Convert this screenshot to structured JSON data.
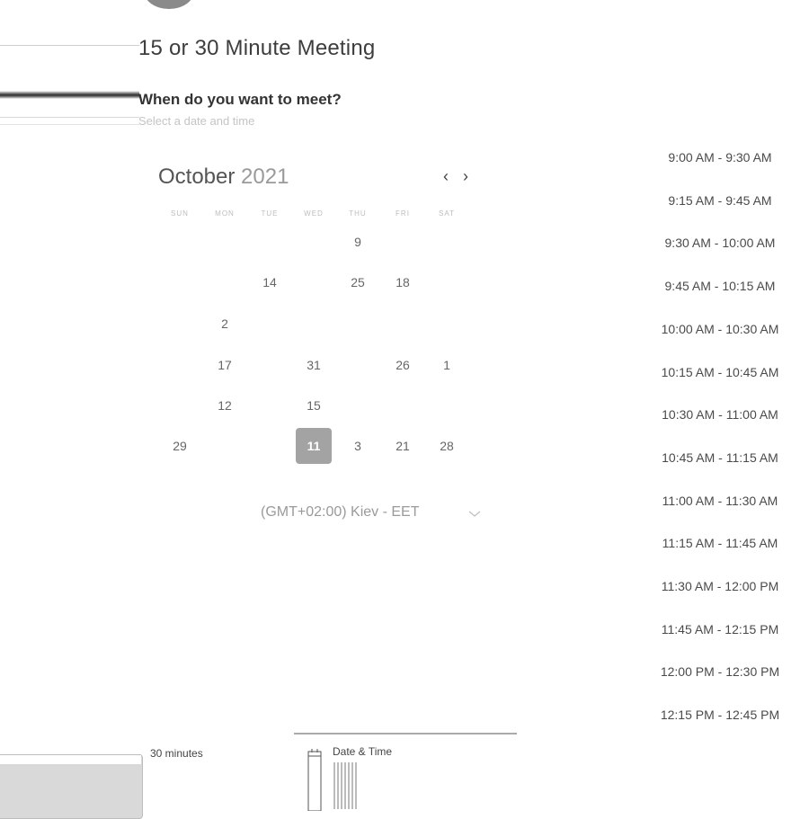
{
  "meeting": {
    "title": "15 or 30 Minute Meeting",
    "question": "When do you want to meet?",
    "hint": "Select a date and time"
  },
  "calendar": {
    "month": "October",
    "year": "2021",
    "weekdays": [
      "SUN",
      "MON",
      "TUE",
      "WED",
      "THU",
      "FRI",
      "SAT"
    ],
    "days": [
      {
        "label": "9",
        "col": 4,
        "row": 0,
        "selected": false
      },
      {
        "label": "14",
        "col": 2,
        "row": 1,
        "selected": false
      },
      {
        "label": "25",
        "col": 4,
        "row": 1,
        "selected": false
      },
      {
        "label": "18",
        "col": 5,
        "row": 1,
        "selected": false
      },
      {
        "label": "2",
        "col": 1,
        "row": 2,
        "selected": false
      },
      {
        "label": "17",
        "col": 1,
        "row": 3,
        "selected": false
      },
      {
        "label": "31",
        "col": 3,
        "row": 3,
        "selected": false
      },
      {
        "label": "26",
        "col": 5,
        "row": 3,
        "selected": false
      },
      {
        "label": "1",
        "col": 6,
        "row": 3,
        "selected": false
      },
      {
        "label": "12",
        "col": 1,
        "row": 4,
        "selected": false
      },
      {
        "label": "15",
        "col": 3,
        "row": 4,
        "selected": false
      },
      {
        "label": "29",
        "col": 0,
        "row": 5,
        "selected": false
      },
      {
        "label": "11",
        "col": 3,
        "row": 5,
        "selected": true
      },
      {
        "label": "3",
        "col": 4,
        "row": 5,
        "selected": false
      },
      {
        "label": "21",
        "col": 5,
        "row": 5,
        "selected": false
      },
      {
        "label": "28",
        "col": 6,
        "row": 5,
        "selected": false
      }
    ],
    "prev_icon": "chevron-left-icon",
    "next_icon": "chevron-right-icon"
  },
  "timezone": {
    "label": "(GMT+02:00) Kiev - EET",
    "icon": "chevron-down-icon"
  },
  "time_slots": [
    "9:00 AM - 9:30 AM",
    "9:15 AM - 9:45 AM",
    "9:30 AM - 10:00 AM",
    "9:45 AM - 10:15 AM",
    "10:00 AM - 10:30 AM",
    "10:15 AM - 10:45 AM",
    "10:30 AM - 11:00 AM",
    "10:45 AM - 11:15 AM",
    "11:00 AM - 11:30 AM",
    "11:15 AM - 11:45 AM",
    "11:30 AM - 12:00 PM",
    "11:45 AM - 12:15 PM",
    "12:00 PM - 12:30 PM",
    "12:15 PM - 12:45 PM"
  ],
  "footer": {
    "duration": "30 minutes",
    "date_time_label": "Date & Time",
    "date_time_icon": "calendar-icon"
  },
  "colors": {
    "selected_day": "#a3a3a3",
    "avatar": "#8a8a8a"
  }
}
